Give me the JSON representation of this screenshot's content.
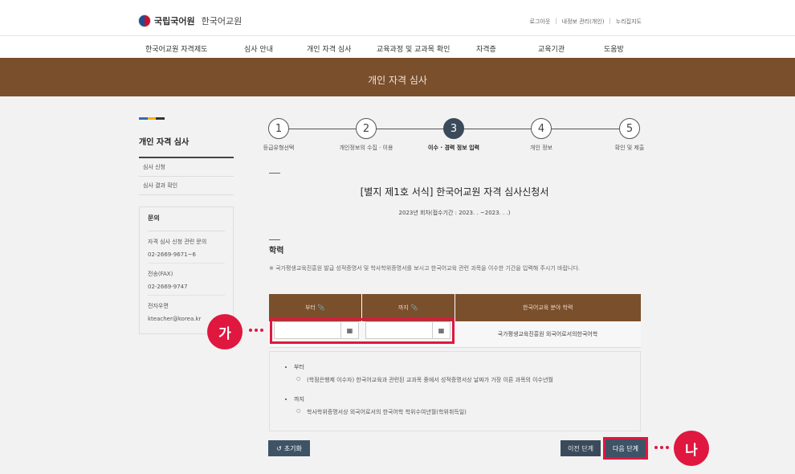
{
  "header": {
    "logo_main": "국립국어원",
    "logo_sub": "한국어교원",
    "util": [
      "로그아웃",
      "내정보 관리(개인)",
      "누리집지도"
    ]
  },
  "gnb": [
    "한국어교원 자격제도",
    "심사 안내",
    "개인 자격 심사",
    "교육과정 및 교과목 확인",
    "자격증",
    "교육기관",
    "도움방"
  ],
  "banner": {
    "title": "개인 자격 심사"
  },
  "sidebar": {
    "title": "개인 자격 심사",
    "links": [
      "심사 신청",
      "심사 결과 확인"
    ],
    "contact": {
      "heading": "문의",
      "items": [
        {
          "label": "자격 심사 신청 관련 문의",
          "value": "02-2669-9671~6"
        },
        {
          "label": "전송(FAX)",
          "value": "02-2669-9747"
        },
        {
          "label": "전자우편",
          "value": "kteacher@korea.kr"
        }
      ]
    }
  },
  "steps": [
    {
      "num": "1",
      "label": "등급유형선택"
    },
    {
      "num": "2",
      "label": "개인정보의 수집 · 이용"
    },
    {
      "num": "3",
      "label": "이수 · 경력 정보 입력"
    },
    {
      "num": "4",
      "label": "개인 정보"
    },
    {
      "num": "5",
      "label": "확인 및 제출"
    }
  ],
  "form": {
    "title": "[별지 제1호 서식] 한국어교원 자격 심사신청서",
    "subtitle": "2023년      회차(접수기간 : 2023.    .    ~2023.    .    .)"
  },
  "section": {
    "title": "학력",
    "note": "※ 국가평생교육진흥원 발급 성적증명서 및 학사학위증명서를 보시고 한국어교육 관련 과목을 이수한 기간을 입력해 주시기 바랍니다."
  },
  "table": {
    "headers": [
      "부터",
      "까지",
      "한국어교육 분야 학력"
    ],
    "row": {
      "from": "",
      "to": "",
      "field": "국가평생교육진흥원 외국어로서의한국어학"
    }
  },
  "guide": {
    "items": [
      {
        "title": "부터",
        "desc": "(학점은행제 이수자) 한국어교육과 관련된 교과목 중에서 성적증명서상 날짜가 가장 이른 과목의 이수년월"
      },
      {
        "title": "까지",
        "desc": "학사학위증명서상 외국어로서의 한국어학 학위수여년월(학위취득일)"
      }
    ]
  },
  "buttons": {
    "reset": "초기화",
    "prev": "이전 단계",
    "next": "다음 단계"
  },
  "markers": {
    "a": "가",
    "b": "나"
  },
  "colors": {
    "brand_brown": "#7a4f2c",
    "highlight_red": "#e0173f",
    "button_navy": "#3f5366"
  }
}
